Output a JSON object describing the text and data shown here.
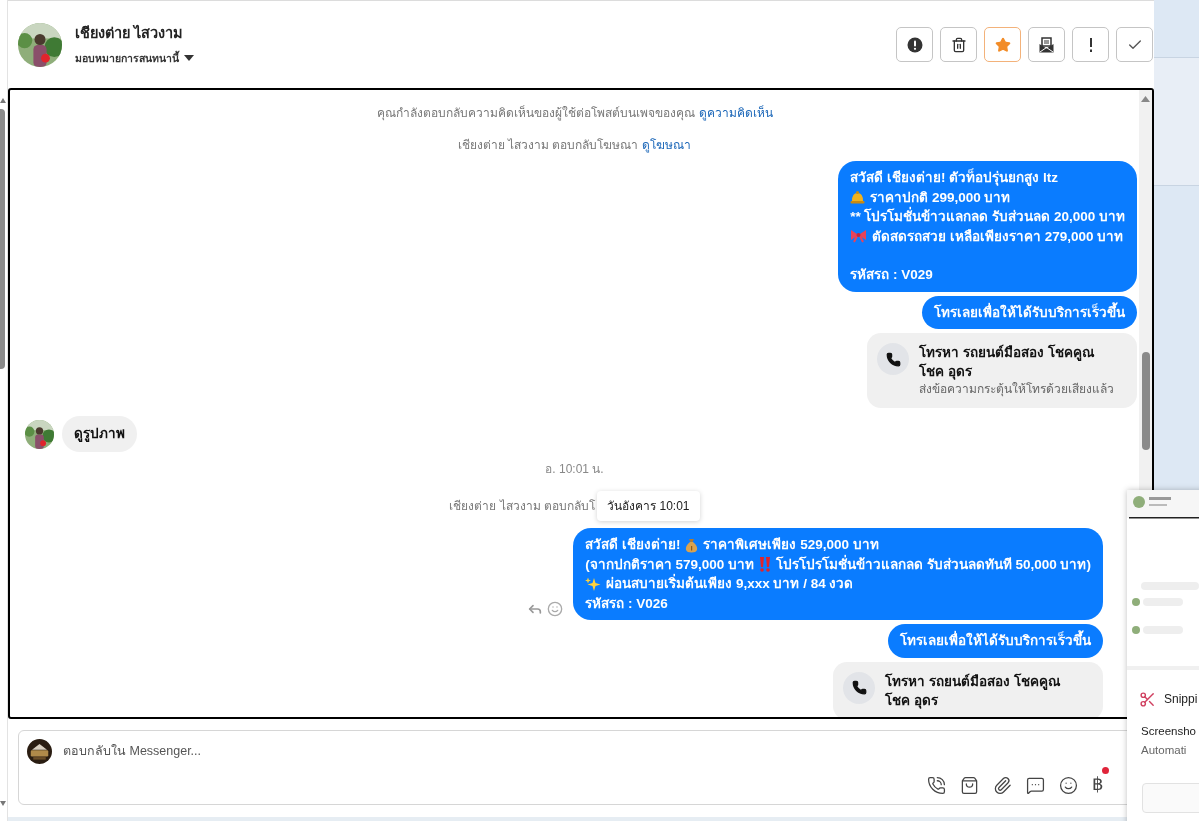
{
  "header": {
    "name": "เชียงต่าย ไสวงาม",
    "assign": "มอบหมายการสนทนานี้",
    "actions": [
      {
        "kind": "alert",
        "active": false
      },
      {
        "kind": "trash",
        "active": false
      },
      {
        "kind": "star",
        "active": true
      },
      {
        "kind": "mail",
        "active": false
      },
      {
        "kind": "exclaim",
        "active": false
      },
      {
        "kind": "check",
        "active": false
      }
    ]
  },
  "messages": [
    {
      "kind": "system",
      "text": "คุณกำลังตอบกลับความคิดเห็นของผู้ใช้ต่อโพสต์บนเพจของคุณ",
      "link": "ดูความคิดเห็น"
    },
    {
      "kind": "system",
      "text": "เชียงต่าย ไสวงาม ตอบกลับโฆษณา",
      "link": "ดูโฆษณา"
    },
    {
      "kind": "outgoing",
      "lines": [
        {
          "parts": [
            {
              "kind": "text",
              "text": "สวัสดี เชียงต่าย! ตัวท็อปรุ่นยกสูง ltz"
            }
          ]
        },
        {
          "parts": [
            {
              "kind": "bell"
            },
            {
              "kind": "text",
              "text": "ราคาปกติ 299,000 บาท"
            }
          ]
        },
        {
          "parts": [
            {
              "kind": "text",
              "text": "** โปรโมชั่นข้าวแลกลด รับส่วนลด 20,000 บาท"
            }
          ]
        },
        {
          "parts": [
            {
              "kind": "bow"
            },
            {
              "kind": "text",
              "text": "ตัดสดรถสวย เหลือเพียงราคา 279,000 บาท"
            }
          ]
        },
        {
          "kind": "blank"
        },
        {
          "parts": [
            {
              "kind": "text",
              "text": "รหัสรถ : V029"
            }
          ]
        }
      ]
    },
    {
      "kind": "outgoing",
      "lines": [
        {
          "parts": [
            {
              "kind": "text",
              "text": "โทรเลยเพื่อให้ได้รับบริการเร็วขึ้น"
            }
          ]
        }
      ]
    },
    {
      "kind": "call_card",
      "title": "โทรหา รถยนต์มือสอง โชคคูณ โชค อุดร",
      "subtitle": "ส่งข้อความกระตุ้นให้โทรด้วยเสียงแล้ว"
    },
    {
      "kind": "incoming",
      "text": "ดูรูปภาพ"
    },
    {
      "kind": "timestamp",
      "text": "อ. 10:01 น."
    },
    {
      "kind": "system",
      "text": "เชียงต่าย ไสวงาม ตอบกลับโ",
      "tooltip": "วันอังคาร 10:01"
    },
    {
      "kind": "outgoing",
      "hover_actions": true,
      "lines": [
        {
          "parts": [
            {
              "kind": "text",
              "text": "สวัสดี เชียงต่าย!"
            },
            {
              "kind": "moneybag"
            },
            {
              "kind": "text",
              "text": "ราคาพิเศษเพียง 529,000 บาท"
            }
          ]
        },
        {
          "parts": [
            {
              "kind": "text",
              "text": "(จากปกติราคา 579,000 บาท"
            },
            {
              "kind": "exclaim"
            },
            {
              "kind": "text",
              "text": "โปรโปรโมชั่นข้าวแลกลด รับส่วนลดทันที 50,000 บาท)"
            }
          ]
        },
        {
          "parts": [
            {
              "kind": "sparkle"
            },
            {
              "kind": "text",
              "text": "ผ่อนสบายเริ่มต้นเพียง 9,xxx บาท / 84 งวด"
            }
          ]
        },
        {
          "parts": [
            {
              "kind": "text",
              "text": "รหัสรถ : V026"
            }
          ]
        }
      ]
    },
    {
      "kind": "outgoing",
      "lines": [
        {
          "parts": [
            {
              "kind": "text",
              "text": "โทรเลยเพื่อให้ได้รับบริการเร็วขึ้น"
            }
          ]
        }
      ]
    },
    {
      "kind": "call_card",
      "title": "โทรหา รถยนต์มือสอง โชคคูณ โชค อุดร"
    }
  ],
  "composer": {
    "placeholder": "ตอบกลับใน Messenger...",
    "tools": [
      {
        "kind": "phone_plus"
      },
      {
        "kind": "bag"
      },
      {
        "kind": "clip"
      },
      {
        "kind": "chat"
      },
      {
        "kind": "smile"
      },
      {
        "kind": "baht",
        "glyph": "฿"
      }
    ]
  },
  "notification": {
    "app": "Snippi",
    "title": "Screensho",
    "subtitle": "Automati"
  }
}
